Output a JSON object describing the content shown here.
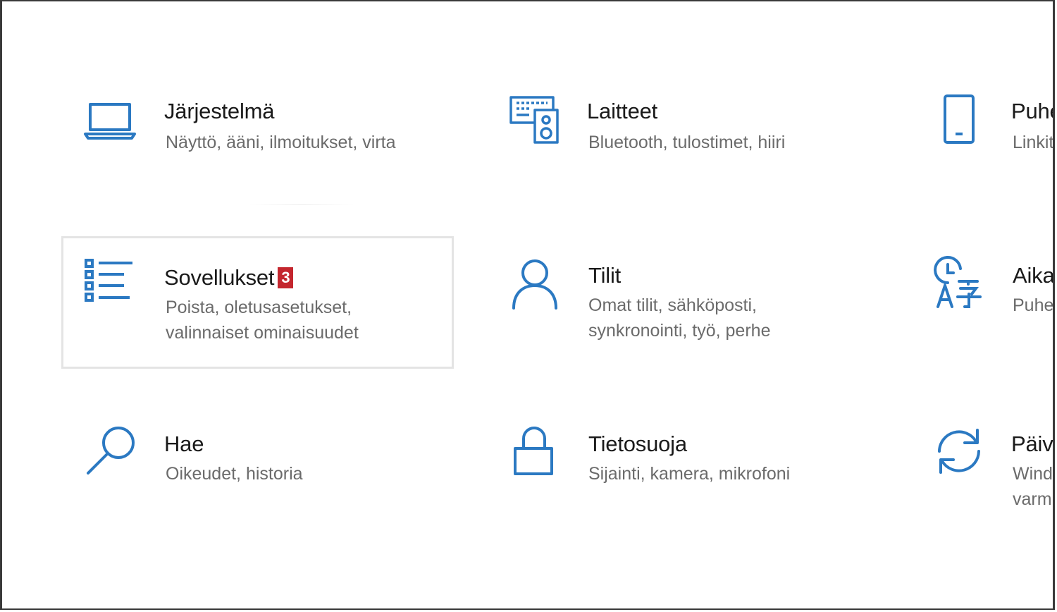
{
  "colors": {
    "accent": "#2b79c2",
    "title_text": "#1a1a1a",
    "description_text": "#6b6b6b",
    "badge_background": "#c4262e",
    "selected_border": "#e4e4e4"
  },
  "tiles": [
    {
      "title": "Järjestelmä",
      "description": "Näyttö, ääni, ilmoitukset, virta",
      "icon": "laptop-icon"
    },
    {
      "title": "Laitteet",
      "description": "Bluetooth, tulostimet, hiiri",
      "icon": "keyboard-speaker-icon"
    },
    {
      "title": "Puhe",
      "description": "Linkit",
      "icon": "phone-icon"
    },
    {
      "title": "Sovellukset",
      "badge": "3",
      "description": "Poista, oletusasetukset, valinnaiset ominaisuudet",
      "icon": "apps-list-icon",
      "selected": true
    },
    {
      "title": "Tilit",
      "description": "Omat tilit, sähköposti, synkronointi, työ, perhe",
      "icon": "person-icon"
    },
    {
      "title": "Aika",
      "description": "Puhe,",
      "icon": "time-language-icon"
    },
    {
      "title": "Hae",
      "description": "Oikeudet, historia",
      "icon": "search-icon"
    },
    {
      "title": "Tietosuoja",
      "description": "Sijainti, kamera, mikrofoni",
      "icon": "lock-icon"
    },
    {
      "title": "Päivi",
      "description": "Wind varm",
      "icon": "update-sync-icon"
    }
  ]
}
